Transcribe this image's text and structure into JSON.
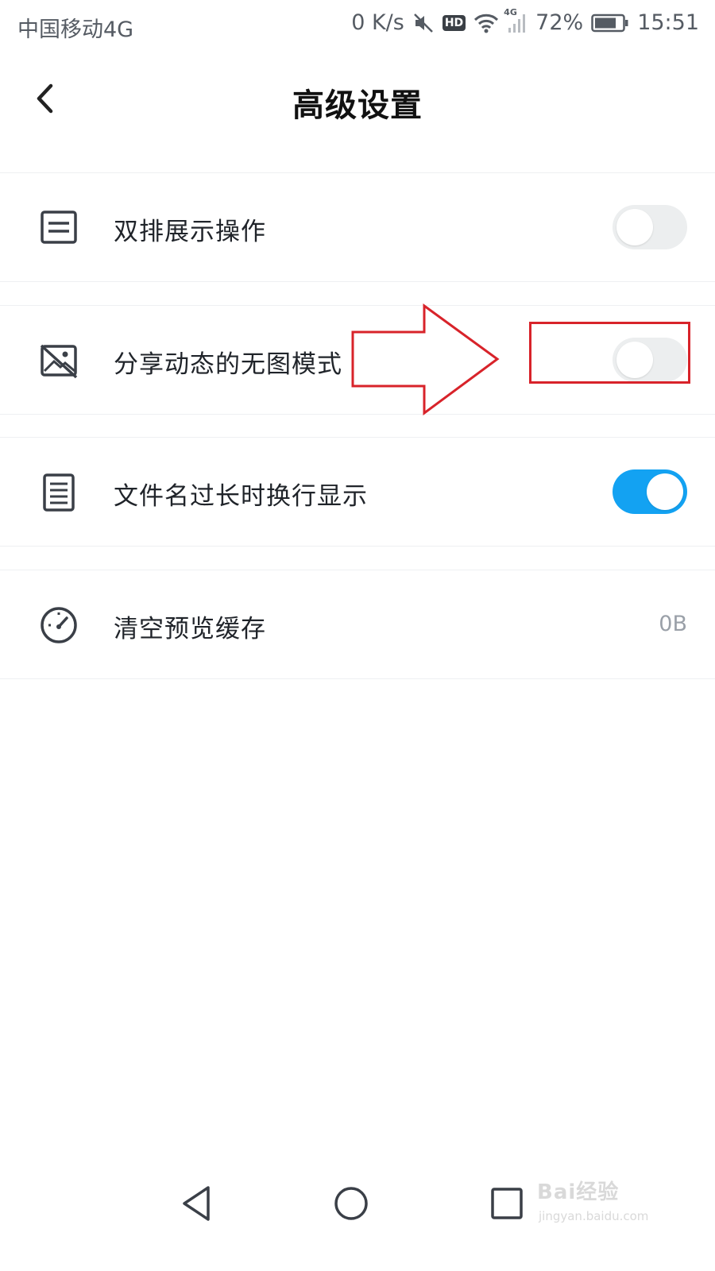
{
  "status_bar": {
    "carrier": "中国移动4G",
    "net_speed": "0 K/s",
    "hd": "HD",
    "network_type": "4G",
    "battery": "72%",
    "time": "15:51"
  },
  "header": {
    "title": "高级设置"
  },
  "settings": [
    {
      "label": "双排展示操作",
      "icon": "list-icon",
      "control": "toggle",
      "on": false
    },
    {
      "label": "分享动态的无图模式",
      "icon": "no-image-icon",
      "control": "toggle",
      "on": false
    },
    {
      "label": "文件名过长时换行显示",
      "icon": "document-icon",
      "control": "toggle",
      "on": true
    },
    {
      "label": "清空预览缓存",
      "icon": "gauge-icon",
      "control": "value",
      "value": "0B"
    }
  ],
  "colors": {
    "toggle_on": "#13a2f2",
    "toggle_off": "#eceeef",
    "annotation": "#d8232a"
  },
  "watermark": {
    "brand": "Bai经验",
    "url": "jingyan.baidu.com"
  }
}
